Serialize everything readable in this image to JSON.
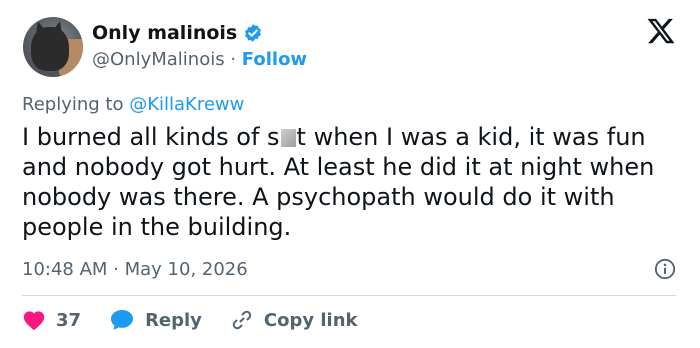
{
  "author": {
    "display_name": "Only malinois",
    "handle": "@OnlyMalinois",
    "separator": "·",
    "follow_label": "Follow"
  },
  "reply_context": {
    "prefix": "Replying to ",
    "mention": "@KillaKreww"
  },
  "tweet": {
    "text_part1": "I burned all kinds of s",
    "text_part2": "t when I was a kid, it was fun and nobody got hurt.  At least he did it at night when nobody was there.  A psychopath would do it with people in the building.",
    "timestamp": "10:48 AM · May 10, 2026"
  },
  "actions": {
    "likes_count": "37",
    "reply_label": "Reply",
    "copy_link_label": "Copy link"
  },
  "colors": {
    "accent": "#1d9bf0",
    "like": "#f91880",
    "muted": "#536471"
  },
  "icons": [
    "verified-badge-icon",
    "x-logo-icon",
    "info-icon",
    "heart-icon",
    "reply-bubble-icon",
    "link-icon"
  ]
}
